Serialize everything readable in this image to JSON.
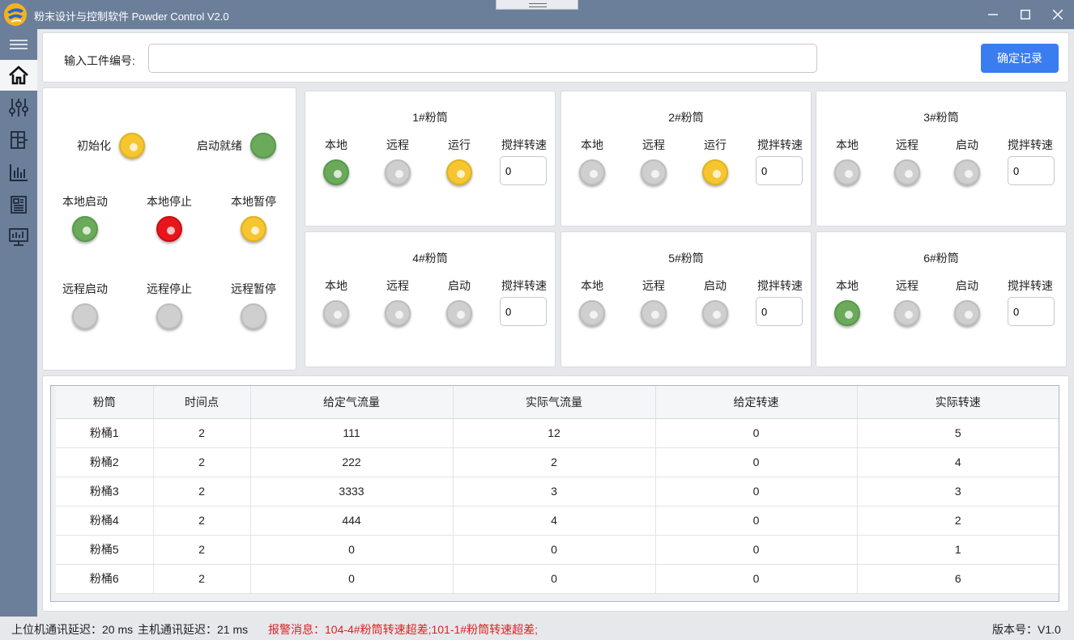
{
  "window": {
    "title": "粉末设计与控制软件 Powder Control V2.0",
    "min_icon": "minimize-icon",
    "max_icon": "maximize-icon",
    "close_icon": "close-icon"
  },
  "sidebar": {
    "items": [
      {
        "icon": "menu-icon",
        "active": false
      },
      {
        "icon": "home-icon",
        "active": true
      },
      {
        "icon": "sliders-icon",
        "active": false
      },
      {
        "icon": "layout-icon",
        "active": false
      },
      {
        "icon": "bar-chart-icon",
        "active": false
      },
      {
        "icon": "report-icon",
        "active": false
      },
      {
        "icon": "monitor-icon",
        "active": false
      }
    ]
  },
  "record": {
    "label": "输入工件编号:",
    "value": "",
    "confirm_label": "确定记录"
  },
  "status": {
    "init_label": "初始化",
    "init_color": "yellow",
    "ready_label": "启动就绪",
    "ready_color": "green",
    "local_start_label": "本地启动",
    "local_start_color": "green",
    "local_stop_label": "本地停止",
    "local_stop_color": "red",
    "local_pause_label": "本地暂停",
    "local_pause_color": "yellow",
    "remote_start_label": "远程启动",
    "remote_start_color": "gray",
    "remote_stop_label": "远程停止",
    "remote_stop_color": "gray",
    "remote_pause_label": "远程暂停",
    "remote_pause_color": "gray"
  },
  "tubes": [
    {
      "title": "1#粉筒",
      "local": "本地",
      "remote": "远程",
      "run": "运行",
      "speed_label": "搅拌转速",
      "speed": "0",
      "local_color": "green",
      "remote_color": "gray",
      "run_color": "yellow"
    },
    {
      "title": "2#粉筒",
      "local": "本地",
      "remote": "远程",
      "run": "运行",
      "speed_label": "搅拌转速",
      "speed": "0",
      "local_color": "gray",
      "remote_color": "gray",
      "run_color": "yellow"
    },
    {
      "title": "3#粉筒",
      "local": "本地",
      "remote": "远程",
      "run": "启动",
      "speed_label": "搅拌转速",
      "speed": "0",
      "local_color": "gray",
      "remote_color": "gray",
      "run_color": "gray"
    },
    {
      "title": "4#粉筒",
      "local": "本地",
      "remote": "远程",
      "run": "启动",
      "speed_label": "搅拌转速",
      "speed": "0",
      "local_color": "gray",
      "remote_color": "gray",
      "run_color": "gray"
    },
    {
      "title": "5#粉筒",
      "local": "本地",
      "remote": "远程",
      "run": "启动",
      "speed_label": "搅拌转速",
      "speed": "0",
      "local_color": "gray",
      "remote_color": "gray",
      "run_color": "gray"
    },
    {
      "title": "6#粉筒",
      "local": "本地",
      "remote": "远程",
      "run": "启动",
      "speed_label": "搅拌转速",
      "speed": "0",
      "local_color": "green",
      "remote_color": "gray",
      "run_color": "gray"
    }
  ],
  "table": {
    "headers": [
      "粉筒",
      "时间点",
      "给定气流量",
      "实际气流量",
      "给定转速",
      "实际转速"
    ],
    "rows": [
      [
        "粉桶1",
        "2",
        "111",
        "12",
        "0",
        "5"
      ],
      [
        "粉桶2",
        "2",
        "222",
        "2",
        "0",
        "4"
      ],
      [
        "粉桶3",
        "2",
        "3333",
        "3",
        "0",
        "3"
      ],
      [
        "粉桶4",
        "2",
        "444",
        "4",
        "0",
        "2"
      ],
      [
        "粉桶5",
        "2",
        "0",
        "0",
        "0",
        "1"
      ],
      [
        "粉桶6",
        "2",
        "0",
        "0",
        "0",
        "6"
      ]
    ]
  },
  "statusbar": {
    "upper_delay": "上位机通讯延迟：20 ms",
    "host_delay": "主机通讯延迟：21 ms",
    "alarm": "报警消息：104-4#粉筒转速超差;101-1#粉筒转速超差;",
    "version": "版本号：V1.0"
  },
  "colors": {
    "chrome": "#6b7f9a",
    "accent": "#3a7df0",
    "alarm": "#e0201f",
    "lamp_green": "#6aaa5a",
    "lamp_yellow": "#f6c630",
    "lamp_red": "#e8161c",
    "lamp_gray": "#cfcfcf"
  }
}
